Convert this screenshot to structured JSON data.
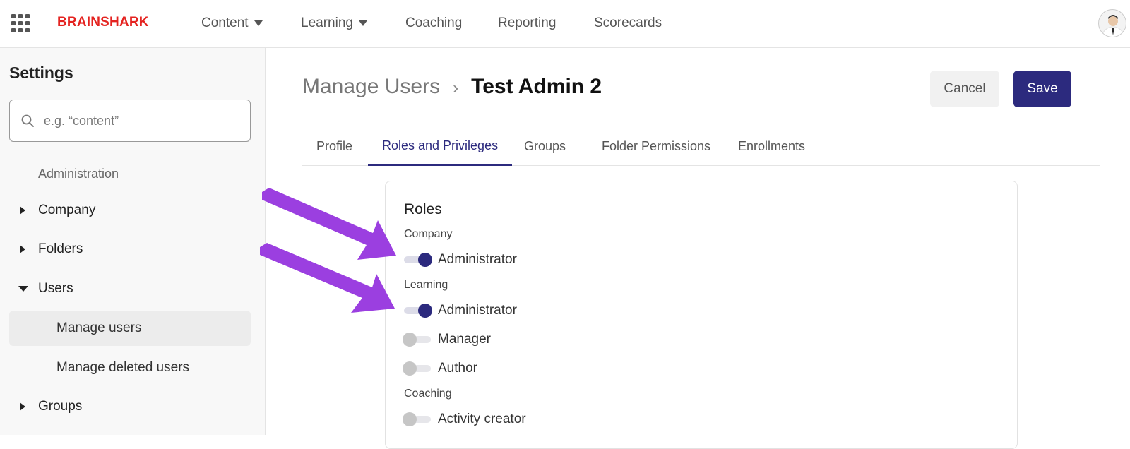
{
  "topbar": {
    "logo": "BRAINSHARK",
    "nav": [
      {
        "label": "Content",
        "has_dropdown": true
      },
      {
        "label": "Learning",
        "has_dropdown": true
      },
      {
        "label": "Coaching",
        "has_dropdown": false
      },
      {
        "label": "Reporting",
        "has_dropdown": false
      },
      {
        "label": "Scorecards",
        "has_dropdown": false
      }
    ]
  },
  "sidebar": {
    "title": "Settings",
    "search_placeholder": "e.g. “content”",
    "section": "Administration",
    "items": [
      {
        "label": "Company",
        "expanded": false
      },
      {
        "label": "Folders",
        "expanded": false
      },
      {
        "label": "Users",
        "expanded": true
      },
      {
        "label": "Groups",
        "expanded": false
      }
    ],
    "sub_items": [
      {
        "label": "Manage users",
        "active": true
      },
      {
        "label": "Manage deleted users",
        "active": false
      }
    ]
  },
  "main": {
    "breadcrumb_parent": "Manage Users",
    "breadcrumb_separator": "›",
    "breadcrumb_current": "Test Admin 2",
    "cancel_label": "Cancel",
    "save_label": "Save",
    "tabs": [
      {
        "label": "Profile",
        "active": false
      },
      {
        "label": "Roles and Privileges",
        "active": true
      },
      {
        "label": "Groups",
        "active": false
      },
      {
        "label": "Folder Permissions",
        "active": false
      },
      {
        "label": "Enrollments",
        "active": false
      }
    ]
  },
  "roles": {
    "title": "Roles",
    "groups": [
      {
        "label": "Company",
        "roles": [
          {
            "label": "Administrator",
            "enabled": true
          }
        ]
      },
      {
        "label": "Learning",
        "roles": [
          {
            "label": "Administrator",
            "enabled": true
          },
          {
            "label": "Manager",
            "enabled": false
          },
          {
            "label": "Author",
            "enabled": false
          }
        ]
      },
      {
        "label": "Coaching",
        "roles": [
          {
            "label": "Activity creator",
            "enabled": false
          }
        ]
      }
    ]
  },
  "colors": {
    "accent": "#2c2a7e",
    "brand": "#e42320",
    "annotation_arrow": "#9b3fe0"
  }
}
